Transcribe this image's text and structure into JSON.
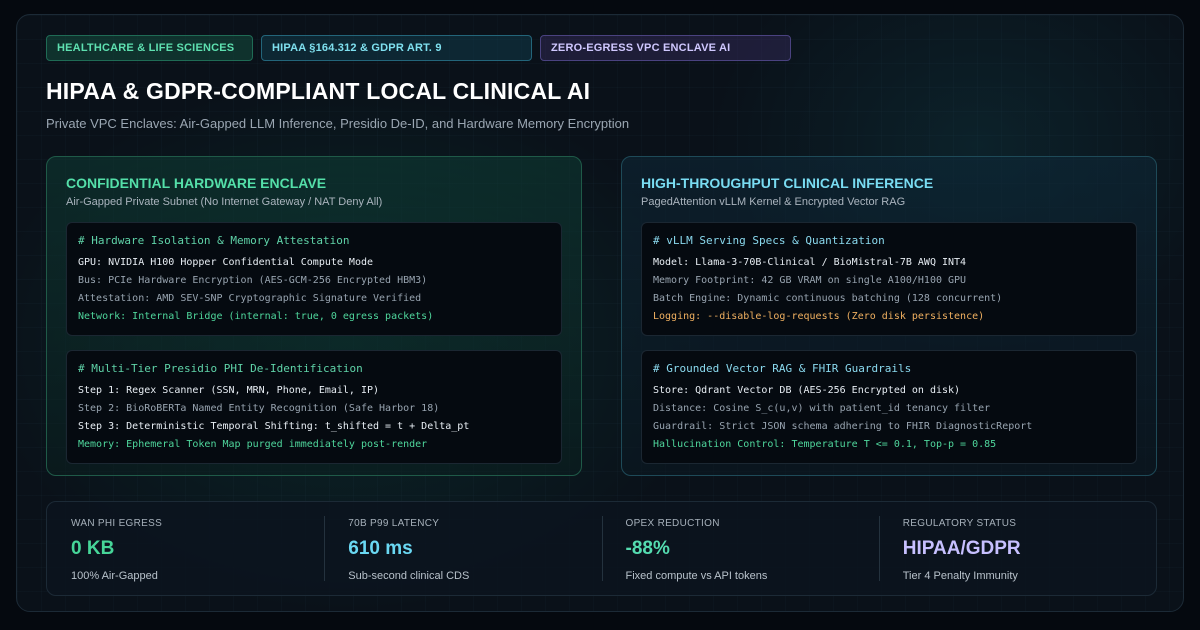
{
  "badges": [
    "HEALTHCARE & LIFE SCIENCES",
    "HIPAA §164.312 & GDPR ART. 9",
    "ZERO-EGRESS VPC ENCLAVE AI"
  ],
  "title": "HIPAA & GDPR-COMPLIANT LOCAL CLINICAL AI",
  "subtitle": "Private VPC Enclaves: Air-Gapped LLM Inference, Presidio De-ID, and Hardware Memory Encryption",
  "left_panel": {
    "title": "CONFIDENTIAL HARDWARE ENCLAVE",
    "subtitle": "Air-Gapped Private Subnet (No Internet Gateway / NAT Deny All)",
    "block1": {
      "heading": "# Hardware Isolation & Memory Attestation",
      "lines": [
        "GPU: NVIDIA H100 Hopper Confidential Compute Mode",
        "Bus: PCIe Hardware Encryption (AES-GCM-256 Encrypted HBM3)",
        "Attestation: AMD SEV-SNP Cryptographic Signature Verified",
        "Network: Internal Bridge (internal: true, 0 egress packets)"
      ]
    },
    "block2": {
      "heading": "# Multi-Tier Presidio PHI De-Identification",
      "lines": [
        "Step 1: Regex Scanner (SSN, MRN, Phone, Email, IP)",
        "Step 2: BioRoBERTa Named Entity Recognition (Safe Harbor 18)",
        "Step 3: Deterministic Temporal Shifting: t_shifted = t + Delta_pt",
        "Memory: Ephemeral Token Map purged immediately post-render"
      ]
    }
  },
  "right_panel": {
    "title": "HIGH-THROUGHPUT CLINICAL INFERENCE",
    "subtitle": "PagedAttention vLLM Kernel & Encrypted Vector RAG",
    "block1": {
      "heading": "# vLLM Serving Specs & Quantization",
      "lines": [
        "Model: Llama-3-70B-Clinical / BioMistral-7B AWQ INT4",
        "Memory Footprint: 42 GB VRAM on single A100/H100 GPU",
        "Batch Engine: Dynamic continuous batching (128 concurrent)",
        "Logging: --disable-log-requests (Zero disk persistence)"
      ]
    },
    "block2": {
      "heading": "# Grounded Vector RAG & FHIR Guardrails",
      "lines": [
        "Store: Qdrant Vector DB (AES-256 Encrypted on disk)",
        "Distance: Cosine S_c(u,v) with patient_id tenancy filter",
        "Guardrail: Strict JSON schema adhering to FHIR DiagnosticReport",
        "Hallucination Control: Temperature T <= 0.1, Top-p = 0.85"
      ]
    }
  },
  "stats": [
    {
      "label": "WAN PHI EGRESS",
      "value": "0 KB",
      "desc": "100% Air-Gapped"
    },
    {
      "label": "70B P99 LATENCY",
      "value": "610 ms",
      "desc": "Sub-second clinical CDS"
    },
    {
      "label": "OPEX REDUCTION",
      "value": "-88%",
      "desc": "Fixed compute vs API tokens"
    },
    {
      "label": "REGULATORY STATUS",
      "value": "HIPAA/GDPR",
      "desc": "Tier 4 Penalty Immunity"
    }
  ],
  "colors": {
    "green": "#46d598",
    "cyan": "#6ad8f3",
    "purple": "#c7c0ff",
    "orange": "#f0b060"
  }
}
